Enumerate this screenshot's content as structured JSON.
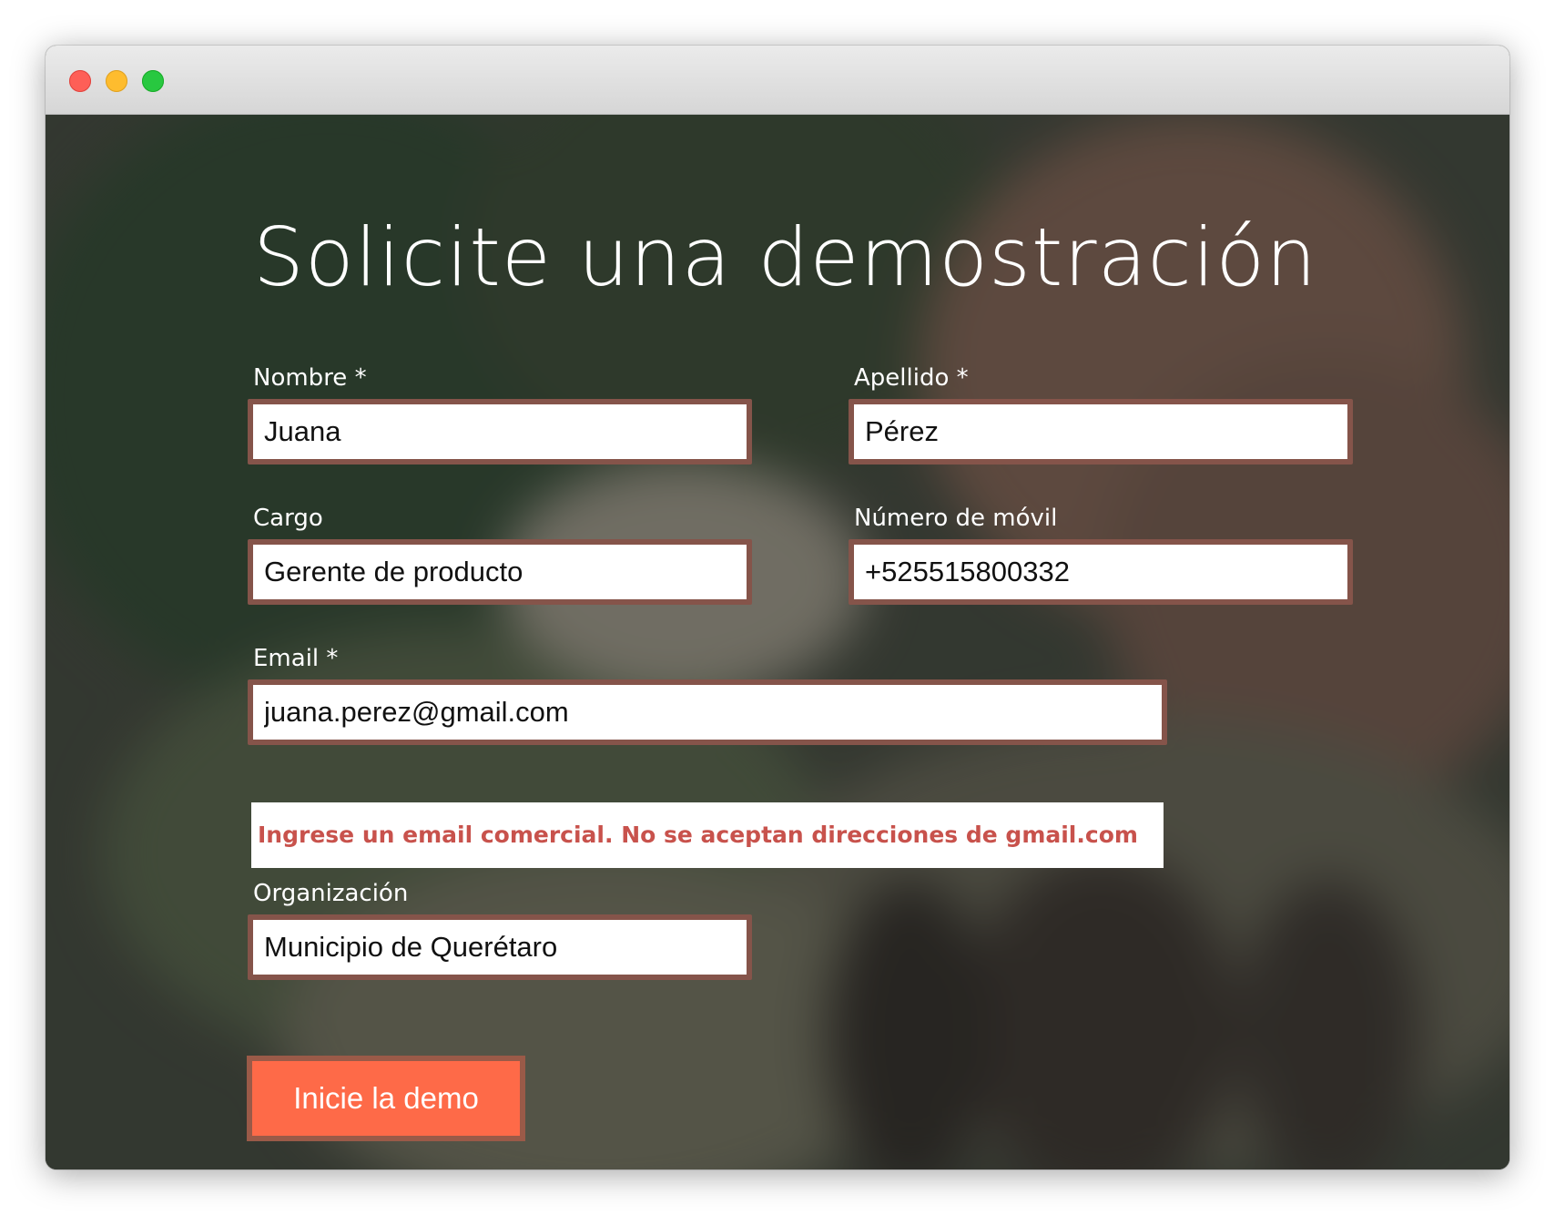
{
  "form": {
    "heading": "Solicite una demostración",
    "first_name": {
      "label": "Nombre *",
      "value": "Juana"
    },
    "last_name": {
      "label": "Apellido *",
      "value": "Pérez"
    },
    "job_title": {
      "label": "Cargo",
      "value": "Gerente de producto"
    },
    "mobile": {
      "label": "Número de móvil",
      "value": "+525515800332"
    },
    "email": {
      "label": "Email *",
      "value": "juana.perez@gmail.com",
      "error": "Ingrese un email comercial. No se aceptan direcciones de gmail.com"
    },
    "organization": {
      "label": "Organización",
      "value": "Municipio de Querétaro"
    },
    "submit_label": "Inicie la demo"
  },
  "colors": {
    "accent": "#fe6a48",
    "error_text": "#c8524c",
    "field_border": "#85544a"
  }
}
